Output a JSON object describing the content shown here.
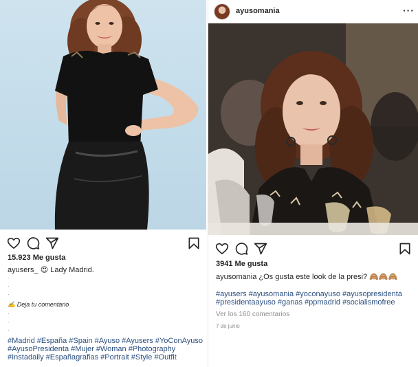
{
  "left_post": {
    "likes": "15.923 Me gusta",
    "caption_user": "ayusers_",
    "caption_emoji": "😍",
    "caption_text": "Lady Madrid.",
    "dots": [
      ".",
      ".",
      ".",
      ".",
      ".",
      "."
    ],
    "add_comment_icon": "✍️",
    "add_comment_text": "Deja tu comentario",
    "hashtag_lines": [
      "#Madrid #España #Spain #Ayuso #Ayusers #YoConAyuso",
      "#AyusoPresidenta #Mujer #Woman #Photography",
      "#Instadaily #Españagrafias #Portrait #Style #Outfit"
    ]
  },
  "right_post": {
    "username": "ayusomania",
    "more_glyph": "···",
    "likes": "3941 Me gusta",
    "caption_user": "ayusomania",
    "caption_text": "¿Os gusta este look de la presi?",
    "caption_emoji": "🙈🙈🙈",
    "hashtag_lines": [
      "#ayusers #ayusomania #yoconayuso #ayusopresidenta",
      "#presidentaayuso #ganas #ppmadrid #socialismofree"
    ],
    "view_comments": "Ver los 160 comentarios",
    "date": "7 de junio"
  },
  "icons": [
    "heart-icon",
    "comment-icon",
    "share-icon",
    "bookmark-icon",
    "more-icon"
  ],
  "colors": {
    "text": "#262626",
    "hashtag": "#2b4f81",
    "muted": "#8e8e8e",
    "left_bg": "#c8e0ec"
  }
}
